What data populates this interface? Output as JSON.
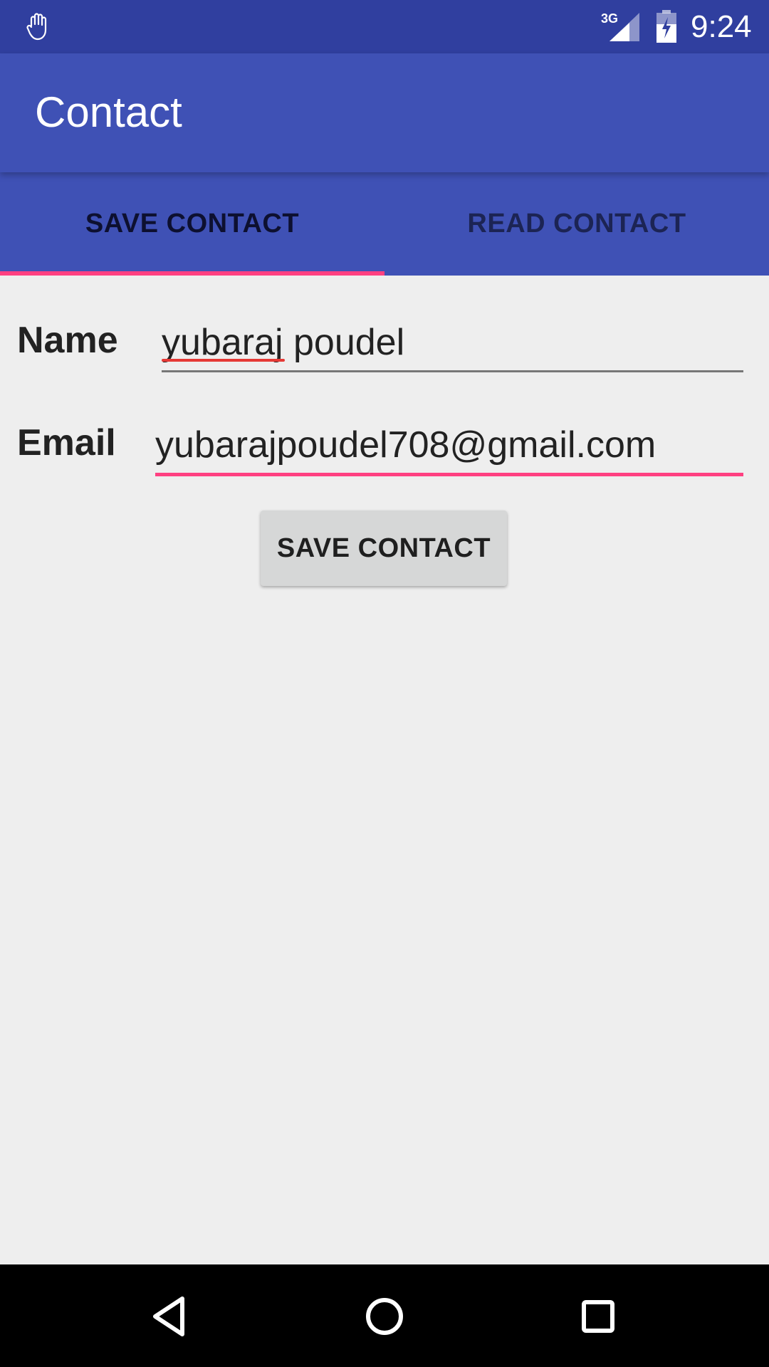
{
  "status_bar": {
    "network": "3G",
    "time": "9:24",
    "icons": [
      "hand-icon",
      "signal-icon",
      "battery-icon"
    ]
  },
  "app_bar": {
    "title": "Contact"
  },
  "tabs": [
    {
      "label": "SAVE CONTACT",
      "selected": true
    },
    {
      "label": "READ CONTACT",
      "selected": false
    }
  ],
  "form": {
    "name_label": "Name",
    "name_value": "yubaraj poudel",
    "email_label": "Email",
    "email_value": "yubarajpoudel708@gmail.com",
    "save_button_label": "SAVE CONTACT"
  },
  "nav_bar": {
    "icons": [
      "back-icon",
      "home-icon",
      "recent-apps-icon"
    ]
  },
  "colors": {
    "primary": "#3f51b5",
    "primary_dark": "#303f9f",
    "accent": "#ff4081",
    "background": "#eeeeee"
  }
}
